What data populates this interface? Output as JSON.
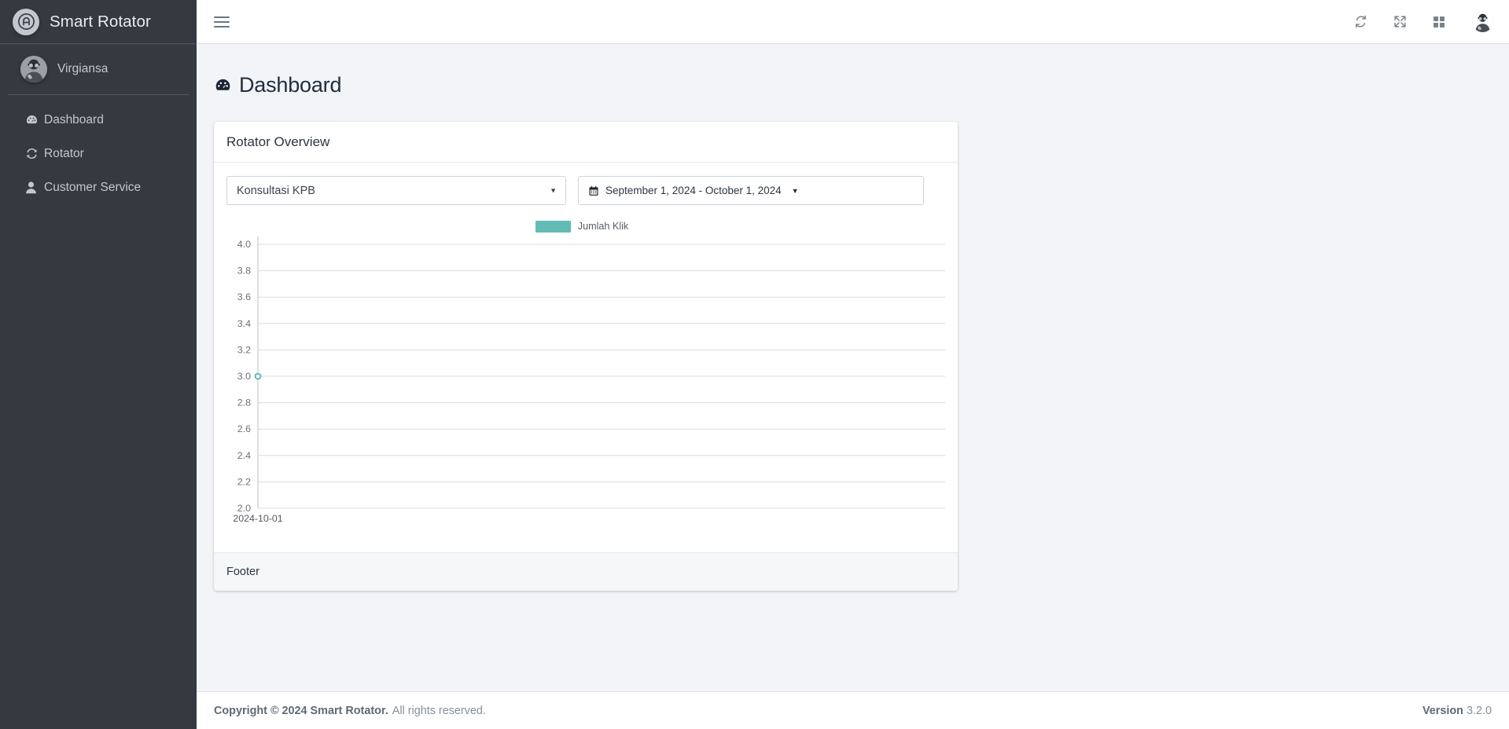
{
  "brand": {
    "name": "Smart Rotator",
    "logo_icon": "rotator-logo-icon"
  },
  "sidebar": {
    "user": {
      "name": "Virgiansa",
      "avatar_icon": "user-avatar"
    },
    "items": [
      {
        "label": "Dashboard",
        "icon": "tachometer-icon"
      },
      {
        "label": "Rotator",
        "icon": "sync-icon"
      },
      {
        "label": "Customer Service",
        "icon": "user-icon"
      }
    ]
  },
  "navbar": {
    "menu_toggle_icon": "hamburger-icon",
    "icons": [
      {
        "name": "refresh-icon"
      },
      {
        "name": "expand-arrows-icon"
      },
      {
        "name": "grid-apps-icon"
      }
    ],
    "avatar_icon": "user-avatar"
  },
  "page": {
    "title": "Dashboard",
    "title_icon": "tachometer-icon"
  },
  "card": {
    "title": "Rotator Overview",
    "footer": "Footer",
    "rotator_select": {
      "value": "Konsultasi KPB",
      "caret_icon": "chevron-down-icon"
    },
    "date_range": {
      "value": "September 1, 2024 - October 1, 2024",
      "calendar_icon": "calendar-icon",
      "caret_icon": "caret-down-icon"
    }
  },
  "footer": {
    "copyright_strong": "Copyright © 2024 Smart Rotator.",
    "copyright_rest": "All rights reserved.",
    "version_label": "Version",
    "version_number": "3.2.0"
  },
  "colors": {
    "sidebar_bg": "#343a40",
    "accent_teal": "#63bbb5",
    "page_bg": "#f2f4f8",
    "card_bg": "#ffffff"
  },
  "chart_data": {
    "type": "line",
    "title": "",
    "xlabel": "",
    "ylabel": "",
    "legend": [
      {
        "name": "Jumlah Klik",
        "color": "#63bbb5"
      }
    ],
    "legend_position": "top-center",
    "grid": true,
    "x": [
      "2024-10-01"
    ],
    "xtick_labels": [
      "2024-10-01"
    ],
    "ytick_labels": [
      "2.0",
      "2.2",
      "2.4",
      "2.6",
      "2.8",
      "3.0",
      "3.2",
      "3.4",
      "3.6",
      "3.8",
      "4.0"
    ],
    "ylim": [
      2.0,
      4.0
    ],
    "series": [
      {
        "name": "Jumlah Klik",
        "color": "#63bbb5",
        "values": [
          3.0
        ]
      }
    ]
  }
}
